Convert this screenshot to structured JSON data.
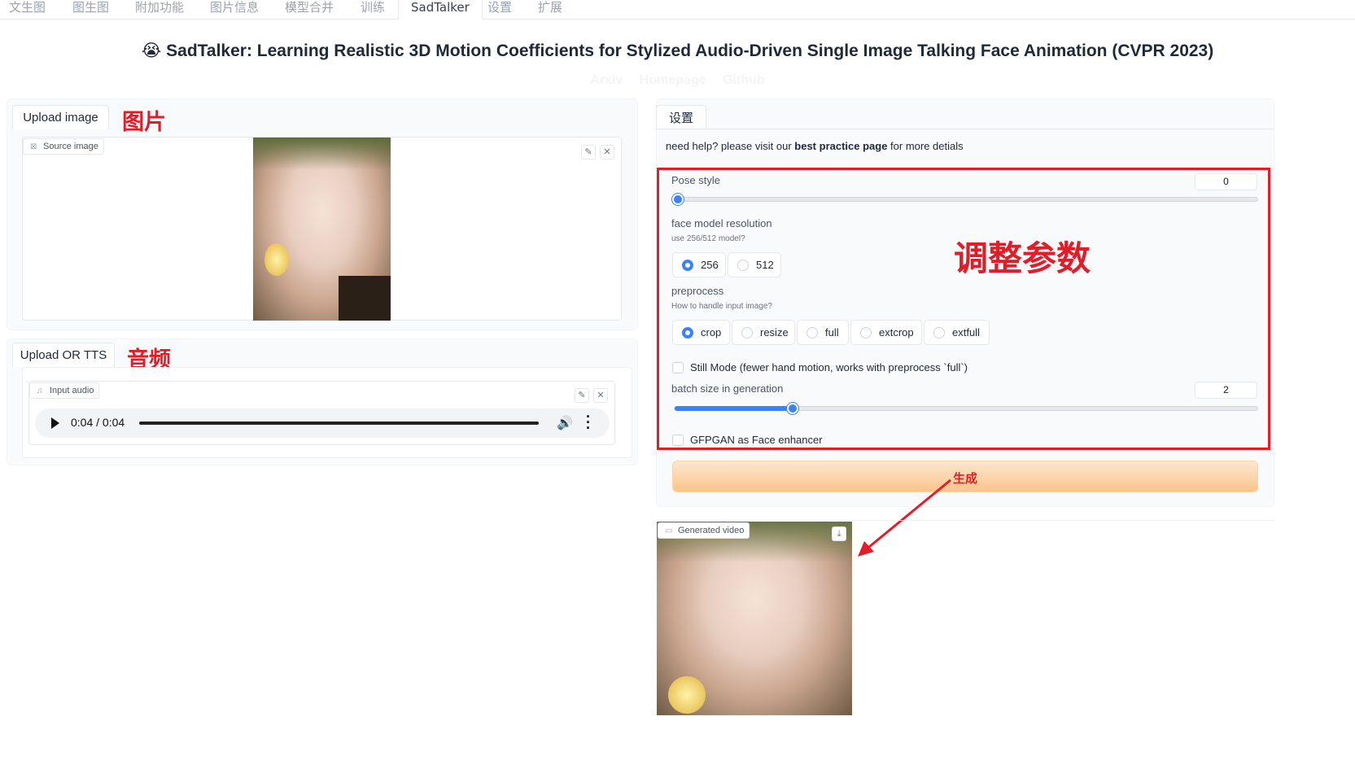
{
  "topnav": {
    "tabs": [
      "文生图",
      "图生图",
      "附加功能",
      "图片信息",
      "模型合并",
      "训练",
      "SadTalker",
      "设置",
      "扩展"
    ],
    "active": "SadTalker"
  },
  "header": {
    "emoji": "😭",
    "title": "SadTalker: Learning Realistic 3D Motion Coefficients for Stylized Audio-Driven Single Image Talking Face Animation (CVPR 2023)",
    "links": [
      "Arxiv",
      "Homepage",
      "Github"
    ]
  },
  "left": {
    "image_tab": "Upload image",
    "image_annotation": "图片",
    "source_image_label": "Source image",
    "audio_tab": "Upload OR TTS",
    "audio_annotation": "音频",
    "input_audio_label": "Input audio",
    "audio_time": "0:04 / 0:04"
  },
  "right": {
    "settings_tab": "设置",
    "help_prefix": "need help? please visit our ",
    "help_link": "best practice page",
    "help_suffix": " for more detials",
    "params_annotation": "调整参数",
    "pose_style": {
      "label": "Pose style",
      "value": "0",
      "fraction": 0.0
    },
    "face_res": {
      "label": "face model resolution",
      "hint": "use 256/512 model?",
      "options": [
        "256",
        "512"
      ],
      "selected": "256"
    },
    "preprocess": {
      "label": "preprocess",
      "hint": "How to handle input image?",
      "options": [
        "crop",
        "resize",
        "full",
        "extcrop",
        "extfull"
      ],
      "selected": "crop"
    },
    "still_mode": "Still Mode (fewer hand motion, works with preprocess `full`)",
    "batch": {
      "label": "batch size in generation",
      "value": "2",
      "fraction": 0.2
    },
    "gfpgan": "GFPGAN as Face enhancer",
    "generate_annotation": "生成",
    "generated_video_label": "Generated video"
  },
  "colors": {
    "accent": "#3b82f6",
    "annotation": "#e11d2a",
    "button": "#fbc48b"
  }
}
